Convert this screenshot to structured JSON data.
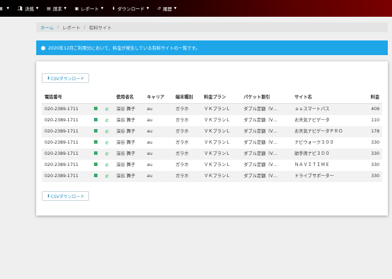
{
  "nav": {
    "items": [
      {
        "label": "",
        "icon": "grid-icon"
      },
      {
        "label": "決裁",
        "icon": "people-icon"
      },
      {
        "label": "請求",
        "icon": "file-icon"
      },
      {
        "label": "レポート",
        "icon": "report-icon"
      },
      {
        "label": "ダウンロード",
        "icon": "download-icon"
      },
      {
        "label": "履歴",
        "icon": "history-icon"
      }
    ]
  },
  "breadcrumb": {
    "home": "ホーム",
    "sep": "/",
    "report": "レポート",
    "current": "有料サイト"
  },
  "alert": {
    "text": "2020年12月ご利用分において、料金が発生している有料サイトの一覧です。"
  },
  "csv_button": {
    "label": "CSVダウンロード",
    "icon": "download-icon"
  },
  "table": {
    "headers": [
      "電話番号",
      "",
      "",
      "使用者名",
      "キャリア",
      "端末種別",
      "料金プラン",
      "パケット割引",
      "サイト名",
      "料金"
    ],
    "rows": [
      {
        "phone": "020-2389-1711",
        "user": "深谷 舞子",
        "carrier": "au",
        "type": "ガラホ",
        "plan": "ＶＫプランＬ",
        "packet": "ダブル定額（V…",
        "site": "ａｕスマートパス",
        "fee": "409"
      },
      {
        "phone": "020-2389-1711",
        "user": "深谷 舞子",
        "carrier": "au",
        "type": "ガラホ",
        "plan": "ＶＫプランＬ",
        "packet": "ダブル定額（V…",
        "site": "お天気ナビゲータ",
        "fee": "110"
      },
      {
        "phone": "020-2389-1711",
        "user": "深谷 舞子",
        "carrier": "au",
        "type": "ガラホ",
        "plan": "ＶＫプランＬ",
        "packet": "ダブル定額（V…",
        "site": "お天気ナビゲータＰＲＯ",
        "fee": "178"
      },
      {
        "phone": "020-2389-1711",
        "user": "深谷 舞子",
        "carrier": "au",
        "type": "ガラホ",
        "plan": "ＶＫプランＬ",
        "packet": "ダブル定額（V…",
        "site": "ナビウォーク３００",
        "fee": "330"
      },
      {
        "phone": "020-2389-1711",
        "user": "深谷 舞子",
        "carrier": "au",
        "type": "ガラホ",
        "plan": "ＶＫプランＬ",
        "packet": "ダブル定額（V…",
        "site": "助手席ナビ３００",
        "fee": "330"
      },
      {
        "phone": "020-2389-1711",
        "user": "深谷 舞子",
        "carrier": "au",
        "type": "ガラホ",
        "plan": "ＶＫプランＬ",
        "packet": "ダブル定額（V…",
        "site": "ＮＡＶＩＴＩＭＥ",
        "fee": "330"
      },
      {
        "phone": "020-2389-1711",
        "user": "深谷 舞子",
        "carrier": "au",
        "type": "ガラホ",
        "plan": "ＶＫプランＬ",
        "packet": "ダブル定額（V…",
        "site": "ドライブサポーター",
        "fee": "330"
      }
    ],
    "row_icons": {
      "sms": "sms-icon",
      "call": "phone-icon"
    }
  },
  "colors": {
    "topbar_start": "#000000",
    "topbar_end": "#7a0000",
    "alert_bg": "#1ea6e9",
    "link": "#2a8fb8",
    "icon_green": "#3aa86b"
  }
}
